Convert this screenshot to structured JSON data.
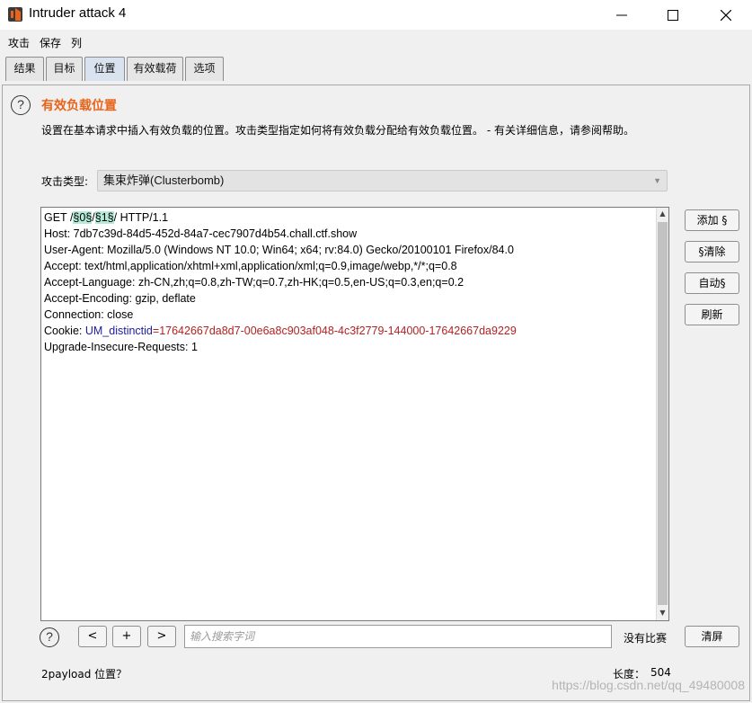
{
  "window": {
    "title": "Intruder attack 4",
    "controls": {
      "minimize": "—",
      "maximize": "☐",
      "close": "✕"
    }
  },
  "menu": [
    "攻击",
    "保存",
    "列"
  ],
  "tabs": [
    {
      "label": "结果",
      "active": false
    },
    {
      "label": "目标",
      "active": false
    },
    {
      "label": "位置",
      "active": true
    },
    {
      "label": "有效载荷",
      "active": false
    },
    {
      "label": "选项",
      "active": false
    }
  ],
  "section": {
    "title": "有效负载位置",
    "description": "设置在基本请求中插入有效负载的位置。攻击类型指定如何将有效负载分配给有效负载位置。 - 有关详细信息，请参阅帮助。"
  },
  "attack_type": {
    "label": "攻击类型:",
    "value": "集束炸弹(Clusterbomb)"
  },
  "request": {
    "line1": {
      "prefix": "GET /",
      "marker1": "§0§",
      "sep": "/",
      "marker2": "§1§",
      "suffix": "/ HTTP/1.1"
    },
    "host": "Host: 7db7c39d-84d5-452d-84a7-cec7907d4b54.chall.ctf.show",
    "user_agent": "User-Agent: Mozilla/5.0 (Windows NT 10.0; Win64; x64; rv:84.0) Gecko/20100101 Firefox/84.0",
    "accept": "Accept: text/html,application/xhtml+xml,application/xml;q=0.9,image/webp,*/*;q=0.8",
    "accept_language": "Accept-Language: zh-CN,zh;q=0.8,zh-TW;q=0.7,zh-HK;q=0.5,en-US;q=0.3,en;q=0.2",
    "accept_encoding": "Accept-Encoding: gzip, deflate",
    "connection": "Connection: close",
    "cookie": {
      "prefix": "Cookie: ",
      "name": "UM_distinctid",
      "eq": "=",
      "value": "17642667da8d7-00e6a8c903af048-4c3f2779-144000-17642667da9229"
    },
    "upgrade": "Upgrade-Insecure-Requests: 1"
  },
  "side_buttons": {
    "add": "添加 §",
    "clear": "§清除",
    "auto": "自动§",
    "refresh": "刷新"
  },
  "search": {
    "help": "?",
    "prev": "<",
    "add": "+",
    "next": ">",
    "placeholder": "输入搜索字词",
    "match_status": "没有比赛",
    "clear_button": "清屏"
  },
  "footer": {
    "positions": "2payload 位置？",
    "length_label": "长度：",
    "length_value": "504"
  },
  "watermark": "https://blog.csdn.net/qq_49480008",
  "colors": {
    "accent": "#e8641a",
    "highlight": "#b4ead9",
    "cookie_name": "#1a1aa6",
    "cookie_value": "#b22222"
  }
}
